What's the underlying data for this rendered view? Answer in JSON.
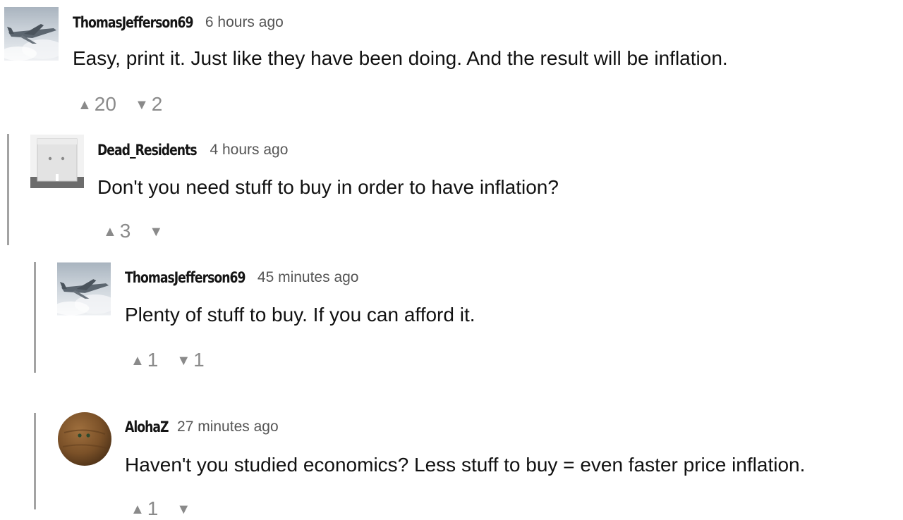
{
  "comments": [
    {
      "username": "ThomasJefferson69",
      "time": "6 hours ago",
      "text": "Easy, print it. Just like they have been doing. And the result will be inflation.",
      "upvotes": "20",
      "downvotes": "2",
      "avatar": "jet-plane-avatar"
    },
    {
      "username": "Dead_Residents",
      "time": "4 hours ago",
      "text": "Don't you need stuff to buy in order to have inflation?",
      "upvotes": "3",
      "downvotes": "",
      "avatar": "box-character-avatar"
    },
    {
      "username": "ThomasJefferson69",
      "time": "45 minutes ago",
      "text": "Plenty of stuff to buy. If you can afford it.",
      "upvotes": "1",
      "downvotes": "1",
      "avatar": "jet-plane-avatar"
    },
    {
      "username": "AlohaZ",
      "time": "27 minutes ago",
      "text": "Haven't you studied economics?  Less stuff to buy = even faster price inflation.",
      "upvotes": "1",
      "downvotes": "",
      "avatar": "coconut-avatar"
    }
  ],
  "icons": {
    "upvote": "▲",
    "downvote": "▼"
  },
  "colors": {
    "thread_rule": "#a3a3a3",
    "vote_gray": "#8a8a8a",
    "timestamp_gray": "#555555"
  }
}
